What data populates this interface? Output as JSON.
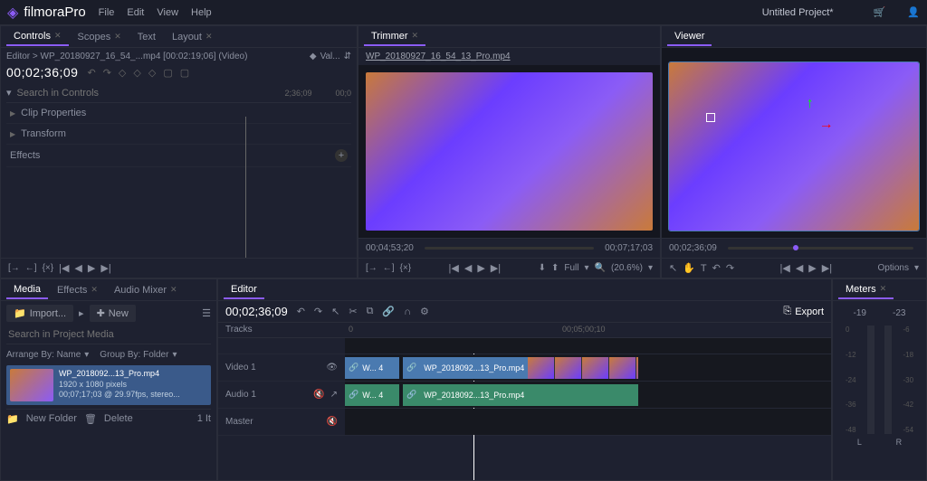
{
  "app": {
    "name": "filmoraPro",
    "project_title": "Untitled Project*"
  },
  "menu": [
    "File",
    "Edit",
    "View",
    "Help"
  ],
  "controls_panel": {
    "tabs": [
      {
        "label": "Controls",
        "active": true
      },
      {
        "label": "Scopes",
        "active": false
      },
      {
        "label": "Text",
        "active": false
      },
      {
        "label": "Layout",
        "active": false
      }
    ],
    "breadcrumb": "Editor > WP_20180927_16_54_...mp4 [00:02:19;06] (Video)",
    "value_label": "Val...",
    "timecode": "00;02;36;09",
    "search_placeholder": "Search in Controls",
    "tc_right1": "2;36;09",
    "tc_right2": "00;0",
    "properties": [
      "Clip Properties",
      "Transform"
    ],
    "effects_label": "Effects"
  },
  "trimmer_panel": {
    "tab": "Trimmer",
    "filename": "WP_20180927_16_54_13_Pro.mp4",
    "tc_left": "00;04;53;20",
    "tc_right": "00;07;17;03",
    "zoom_label": "Full",
    "zoom_pct": "(20.6%)"
  },
  "viewer_panel": {
    "tab": "Viewer",
    "timecode": "00;02;36;09",
    "options_label": "Options"
  },
  "media_panel": {
    "tabs": [
      {
        "label": "Media",
        "active": true
      },
      {
        "label": "Effects",
        "active": false
      },
      {
        "label": "Audio Mixer",
        "active": false
      }
    ],
    "import_label": "Import...",
    "new_label": "New",
    "search_placeholder": "Search in Project Media",
    "arrange_label": "Arrange By: Name",
    "group_label": "Group By: Folder",
    "clip": {
      "name": "WP_2018092...13_Pro.mp4",
      "dims": "1920 x 1080 pixels",
      "meta": "00;07;17;03 @ 29.97fps, stereo..."
    },
    "new_folder": "New Folder",
    "delete_label": "Delete",
    "count": "1 It"
  },
  "editor_panel": {
    "tab": "Editor",
    "timecode": "00;02;36;09",
    "export_label": "Export",
    "tracks_label": "Tracks",
    "ruler_marks": {
      "zero": "0",
      "mid": "00;05;00;10"
    },
    "video_track": "Video 1",
    "audio_track": "Audio 1",
    "master_track": "Master",
    "clip1_label": "W... 4",
    "clip2_label": "WP_2018092...13_Pro.mp4"
  },
  "meters_panel": {
    "tab": "Meters",
    "left_val": "-19",
    "right_val": "-23",
    "scale": [
      "0",
      "-6",
      "-12",
      "-18",
      "-24",
      "-30",
      "-36",
      "-42",
      "-48",
      "-54"
    ],
    "L": "L",
    "R": "R"
  }
}
